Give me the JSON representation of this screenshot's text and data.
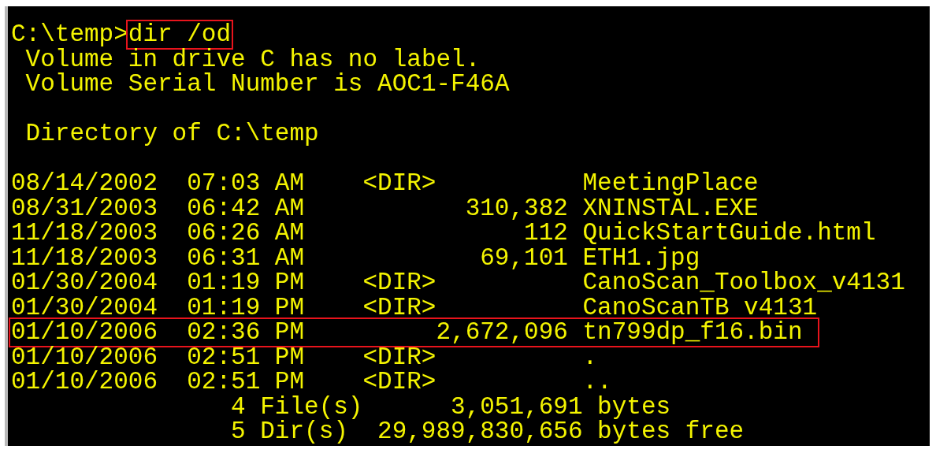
{
  "console": {
    "prompt": {
      "path": "C:\\temp>",
      "command": "dir /od",
      "highlighted": true
    },
    "header_lines": [
      "Volume in drive C has no label.",
      "Volume Serial Number is AOC1-F46A"
    ],
    "directory_line": "Directory of C:\\temp",
    "entries": [
      {
        "date": "08/14/2002",
        "time": "07:03 AM",
        "kind": "dir",
        "tag": "<DIR>",
        "name": "MeetingPlace",
        "highlighted": false
      },
      {
        "date": "08/31/2003",
        "time": "06:42 AM",
        "kind": "file",
        "size": "310,382",
        "name": "XNINSTAL.EXE",
        "highlighted": false
      },
      {
        "date": "11/18/2003",
        "time": "06:26 AM",
        "kind": "file",
        "size": "112",
        "name": "QuickStartGuide.html",
        "highlighted": false
      },
      {
        "date": "11/18/2003",
        "time": "06:31 AM",
        "kind": "file",
        "size": "69,101",
        "name": "ETH1.jpg",
        "highlighted": false
      },
      {
        "date": "01/30/2004",
        "time": "01:19 PM",
        "kind": "dir",
        "tag": "<DIR>",
        "name": "CanoScan_Toolbox_v4131",
        "highlighted": false
      },
      {
        "date": "01/30/2004",
        "time": "01:19 PM",
        "kind": "dir",
        "tag": "<DIR>",
        "name": "CanoScanTB v4131",
        "highlighted": false
      },
      {
        "date": "01/10/2006",
        "time": "02:36 PM",
        "kind": "file",
        "size": "2,672,096",
        "name": "tn799dp_f16.bin",
        "highlighted": true
      },
      {
        "date": "01/10/2006",
        "time": "02:51 PM",
        "kind": "dir",
        "tag": "<DIR>",
        "name": ".",
        "highlighted": false
      },
      {
        "date": "01/10/2006",
        "time": "02:51 PM",
        "kind": "dir",
        "tag": "<DIR>",
        "name": "..",
        "highlighted": false
      }
    ],
    "summary": [
      {
        "count": "4",
        "label": "File(s)",
        "amount": "3,051,691",
        "unit": "bytes"
      },
      {
        "count": "5",
        "label": "Dir(s)",
        "amount": "29,989,830,656",
        "unit": "bytes free"
      }
    ]
  }
}
